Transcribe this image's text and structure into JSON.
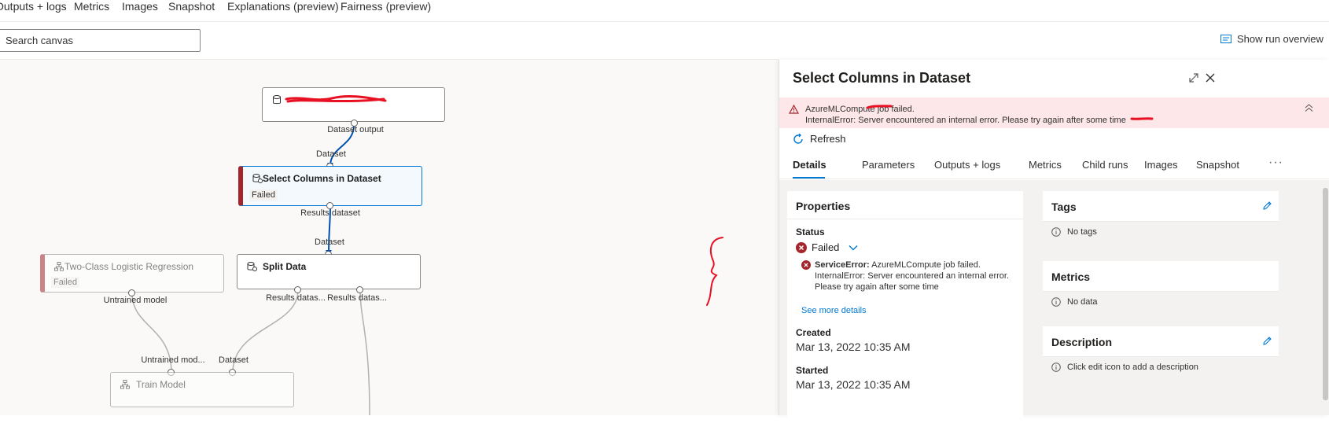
{
  "top_tabs": [
    "Outputs + logs",
    "Metrics",
    "Images",
    "Snapshot",
    "Explanations (preview)",
    "Fairness (preview)"
  ],
  "toolbar": {
    "search_placeholder": "Search canvas",
    "run_overview": "Show run overview"
  },
  "canvas": {
    "nodes": {
      "dataset": {
        "title": "Dataset output",
        "port_out": "Dataset output"
      },
      "select": {
        "title": "Select Columns in Dataset",
        "state": "Failed",
        "port_in": "Dataset",
        "port_out": "Results dataset"
      },
      "logreg": {
        "title": "Two-Class Logistic Regression",
        "state": "Failed",
        "port_out": "Untrained model"
      },
      "split": {
        "title": "Split Data",
        "port_in": "Dataset",
        "port_out_1": "Results datas...",
        "port_out_2": "Results datas..."
      },
      "train": {
        "title": "Train Model",
        "port_in_1": "Untrained mod...",
        "port_in_2": "Dataset"
      }
    }
  },
  "panel": {
    "title": "Select Columns in Dataset",
    "error_line1": "AzureMLCompute job failed.",
    "error_line2": "InternalError: Server encountered an internal error. Please try again after some time",
    "refresh": "Refresh",
    "tabs": [
      "Details",
      "Parameters",
      "Outputs + logs",
      "Metrics",
      "Child runs",
      "Images",
      "Snapshot"
    ],
    "more": "···",
    "properties": {
      "heading": "Properties",
      "status_label": "Status",
      "status_value": "Failed",
      "service_error_prefix": "ServiceError:",
      "service_error_text": " AzureMLCompute job failed. InternalError: Server encountered an internal error. Please try again after some time",
      "see_more": "See more details",
      "created_label": "Created",
      "created_value": "Mar 13, 2022 10:35 AM",
      "started_label": "Started",
      "started_value": "Mar 13, 2022 10:35 AM"
    },
    "tags": {
      "heading": "Tags",
      "empty": "No tags"
    },
    "metrics": {
      "heading": "Metrics",
      "empty": "No data"
    },
    "description": {
      "heading": "Description",
      "empty": "Click edit icon to add a description"
    }
  },
  "colors": {
    "accent": "#0078d4",
    "error": "#a4262c",
    "error_bg": "#fde7e9",
    "annotation": "#e81123"
  },
  "icons": [
    "dataset-icon",
    "module-icon",
    "run-overview-icon",
    "expand-icon",
    "close-icon",
    "warning-icon",
    "collapse-chevron-icon",
    "refresh-icon",
    "error-icon",
    "chevron-down-icon",
    "info-icon",
    "edit-icon"
  ]
}
